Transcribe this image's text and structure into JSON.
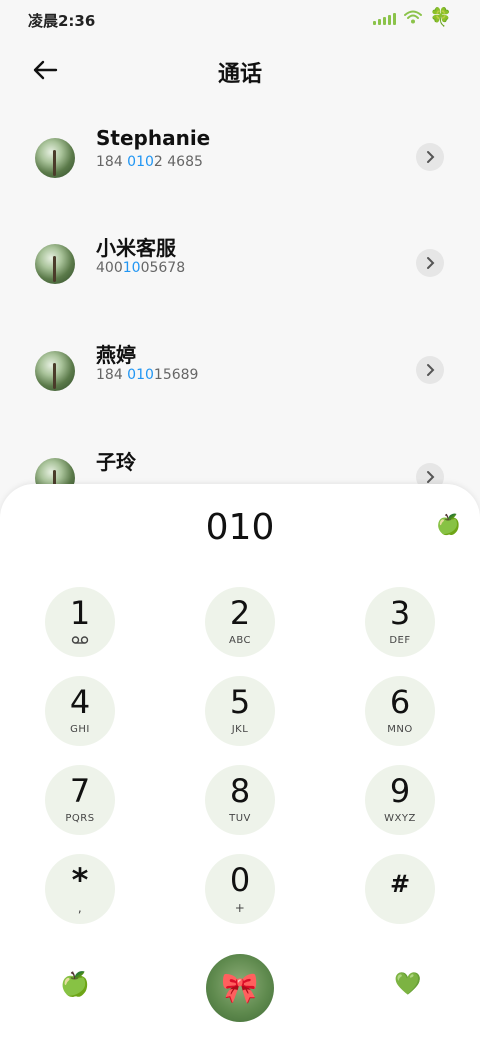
{
  "status_bar": {
    "time": "凌晨2:36",
    "icons": [
      "signal-icon",
      "wifi-icon",
      "clover-icon"
    ],
    "clover_glyph": "🍀"
  },
  "header": {
    "title": "通话",
    "back_icon": "back-arrow-icon"
  },
  "contacts": [
    {
      "name": "Stephanie",
      "number_parts": [
        "184 ",
        "010",
        "2 4685"
      ]
    },
    {
      "name": "小米客服",
      "number_parts": [
        "400",
        "10",
        "05678"
      ]
    },
    {
      "name": "燕婷",
      "number_parts": [
        "184 ",
        "010",
        "15689"
      ]
    },
    {
      "name": "子玲",
      "number_parts": [
        "",
        "",
        ""
      ]
    }
  ],
  "dialer": {
    "typed_number": "010",
    "top_right_glyph": "🍏",
    "keys": [
      {
        "digit": "1",
        "letters": "",
        "icon": "voicemail-icon"
      },
      {
        "digit": "2",
        "letters": "ABC"
      },
      {
        "digit": "3",
        "letters": "DEF"
      },
      {
        "digit": "4",
        "letters": "GHI"
      },
      {
        "digit": "5",
        "letters": "JKL"
      },
      {
        "digit": "6",
        "letters": "MNO"
      },
      {
        "digit": "7",
        "letters": "PQRS"
      },
      {
        "digit": "8",
        "letters": "TUV"
      },
      {
        "digit": "9",
        "letters": "WXYZ"
      },
      {
        "digit": "*",
        "letters": ","
      },
      {
        "digit": "0",
        "letters": "+"
      },
      {
        "digit": "#",
        "letters": ""
      }
    ],
    "bottom_left_glyph": "🍏",
    "call_glyph": "🎀",
    "bottom_right_glyph": "💚"
  },
  "colors": {
    "highlight": "#2196f3",
    "key_bg": "#eef3ea",
    "call_bg": "#5f8a4e",
    "signal": "#8bc34a"
  }
}
